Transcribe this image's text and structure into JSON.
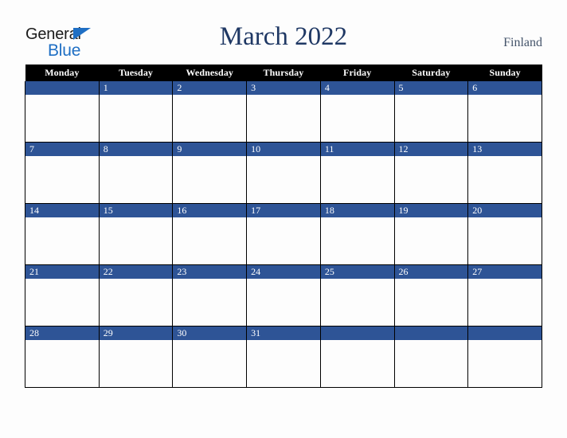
{
  "logo": {
    "word1": "General",
    "word2": "Blue",
    "triangle_icon": "triangle-icon",
    "color_dark": "#1b1b1b",
    "color_blue": "#1f6fc4"
  },
  "header": {
    "title": "March 2022",
    "month": "March",
    "year": "2022",
    "country": "Finland",
    "title_color": "#1f3864",
    "country_color": "#44546a"
  },
  "calendar": {
    "accent_color": "#2e5496",
    "header_bg": "#000000",
    "header_fg": "#ffffff",
    "cell_bg": "#fdfdfd",
    "border_color": "#000000",
    "weekday_headers": [
      "Monday",
      "Tuesday",
      "Wednesday",
      "Thursday",
      "Friday",
      "Saturday",
      "Sunday"
    ],
    "weeks": [
      [
        "",
        "1",
        "2",
        "3",
        "4",
        "5",
        "6"
      ],
      [
        "7",
        "8",
        "9",
        "10",
        "11",
        "12",
        "13"
      ],
      [
        "14",
        "15",
        "16",
        "17",
        "18",
        "19",
        "20"
      ],
      [
        "21",
        "22",
        "23",
        "24",
        "25",
        "26",
        "27"
      ],
      [
        "28",
        "29",
        "30",
        "31",
        "",
        "",
        ""
      ]
    ]
  }
}
